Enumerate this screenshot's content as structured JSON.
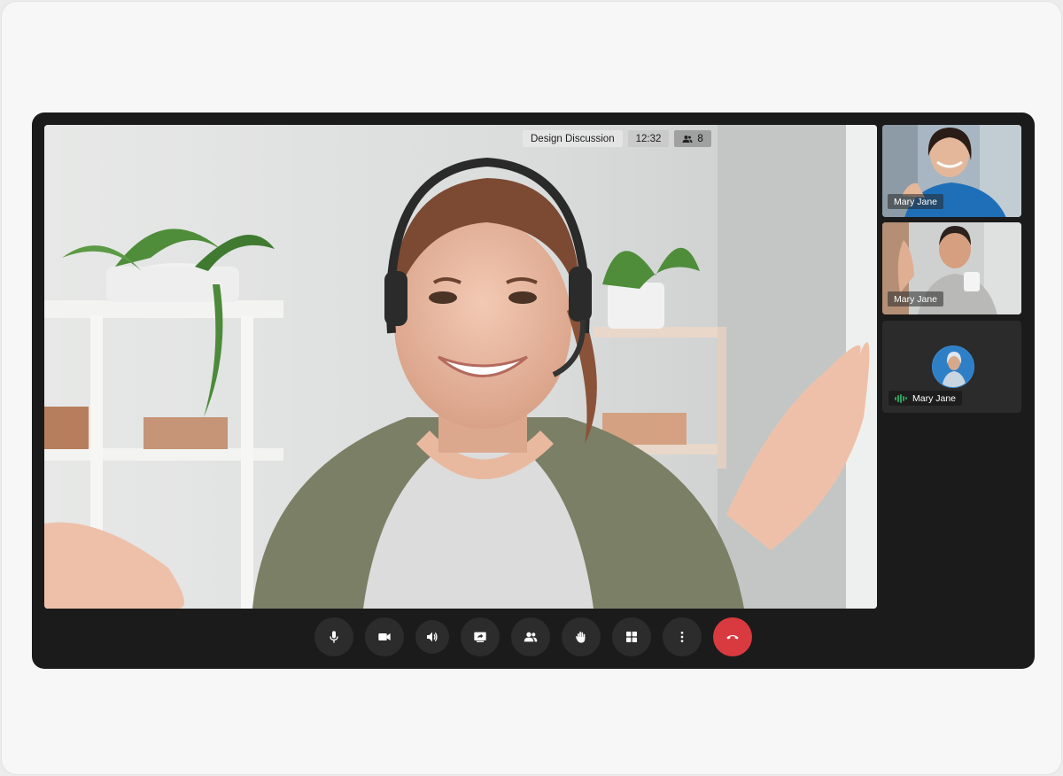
{
  "meeting": {
    "title": "Design Discussion",
    "duration": "12:32",
    "participant_count": "8"
  },
  "participants": [
    {
      "name": "Mary Jane"
    },
    {
      "name": "Mary Jane"
    },
    {
      "name": "Mary Jane",
      "speaking": true
    }
  ],
  "controls": [
    {
      "icon": "microphone-icon"
    },
    {
      "icon": "camera-icon"
    },
    {
      "icon": "speaker-icon"
    },
    {
      "icon": "share-screen-icon"
    },
    {
      "icon": "participants-icon"
    },
    {
      "icon": "raise-hand-icon"
    },
    {
      "icon": "grid-layout-icon"
    },
    {
      "icon": "more-options-icon"
    },
    {
      "icon": "end-call-icon"
    }
  ],
  "colors": {
    "frame": "#1b1b1b",
    "control_button": "#2c2c2c",
    "end_call": "#d83a3f",
    "audio_indicator": "#2aa05b"
  }
}
